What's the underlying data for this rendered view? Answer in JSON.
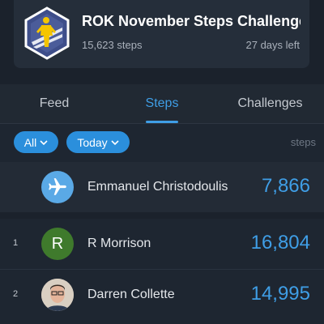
{
  "challenge": {
    "title": "ROK November Steps Challenge ...",
    "steps": "15,623 steps",
    "days_left": "27 days left"
  },
  "tabs": [
    {
      "label": "Feed",
      "active": false
    },
    {
      "label": "Steps",
      "active": true
    },
    {
      "label": "Challenges",
      "active": false
    }
  ],
  "filters": {
    "scope": "All",
    "period": "Today",
    "unit_label": "steps"
  },
  "me": {
    "name": "Emmanuel Christodoulis",
    "steps": "7,866",
    "avatar_icon": "airplane-icon"
  },
  "leaderboard": [
    {
      "rank": "1",
      "name": "R Morrison",
      "steps": "16,804",
      "avatar_initial": "R"
    },
    {
      "rank": "2",
      "name": "Darren Collette",
      "steps": "14,995"
    }
  ],
  "colors": {
    "accent": "#3f9ee6",
    "pill": "#2b8fdc",
    "background": "#1e2631"
  }
}
